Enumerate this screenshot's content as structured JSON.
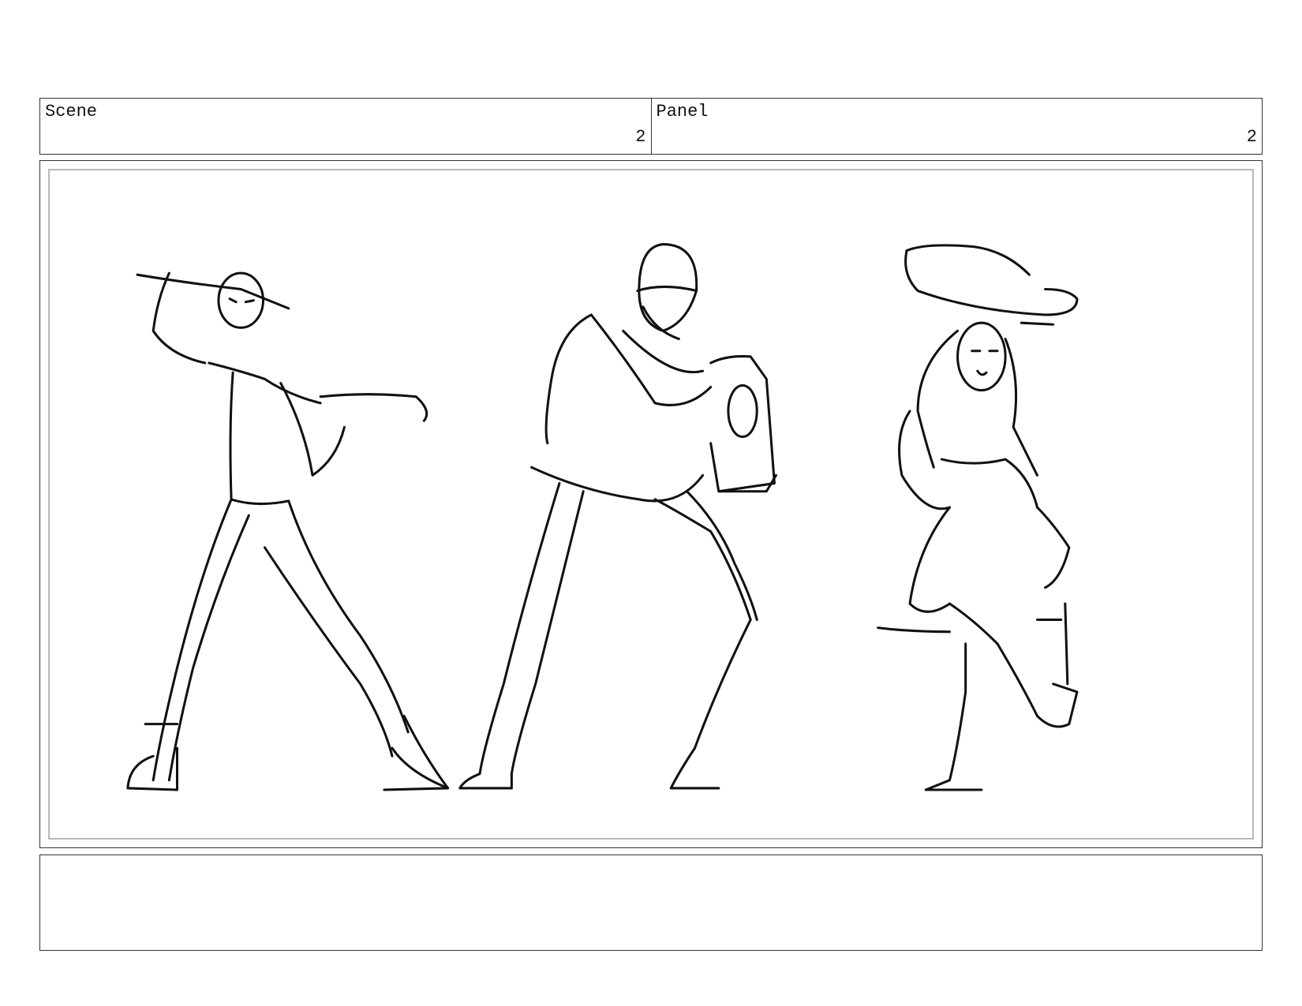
{
  "header": {
    "scene": {
      "label": "Scene",
      "value": "2"
    },
    "panel": {
      "label": "Panel",
      "value": "2"
    }
  },
  "notes": {
    "text": ""
  }
}
